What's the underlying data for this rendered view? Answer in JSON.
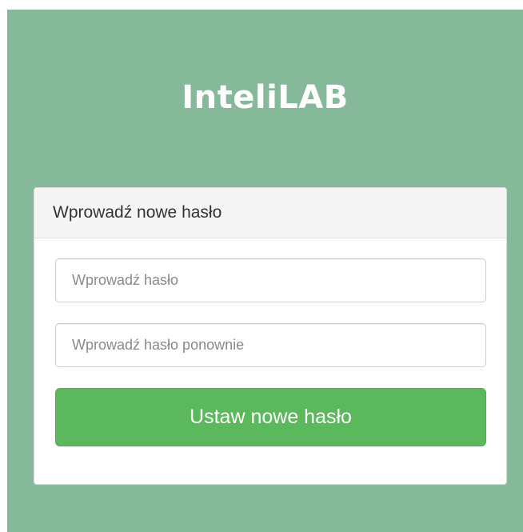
{
  "app": {
    "title": "InteliLAB"
  },
  "form": {
    "heading": "Wprowadź nowe hasło",
    "password": {
      "value": "",
      "placeholder": "Wprowadź hasło"
    },
    "password_confirm": {
      "value": "",
      "placeholder": "Wprowadź hasło ponownie"
    },
    "submit_label": "Ustaw nowe hasło"
  },
  "colors": {
    "background": "#85b99a",
    "submit_button": "#5cb85c",
    "card_header": "#f5f5f5"
  }
}
